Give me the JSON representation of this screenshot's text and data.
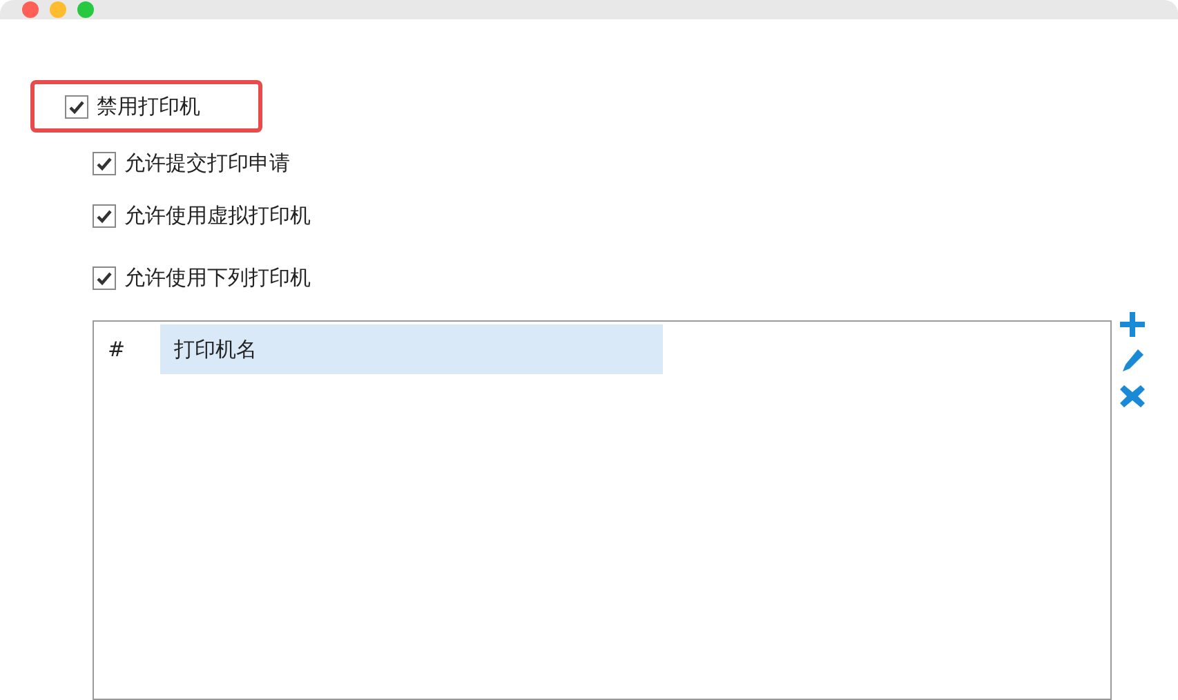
{
  "main_option": {
    "label": "禁用打印机",
    "checked": true,
    "highlighted": true
  },
  "sub_options": [
    {
      "label": "允许提交打印申请",
      "checked": true
    },
    {
      "label": "允许使用虚拟打印机",
      "checked": true
    },
    {
      "label": "允许使用下列打印机",
      "checked": true
    }
  ],
  "printer_table": {
    "columns": [
      {
        "label": "#",
        "selected": false
      },
      {
        "label": "打印机名",
        "selected": true
      }
    ]
  },
  "side_tools": [
    {
      "kind": "add"
    },
    {
      "kind": "edit"
    },
    {
      "kind": "delete"
    }
  ]
}
